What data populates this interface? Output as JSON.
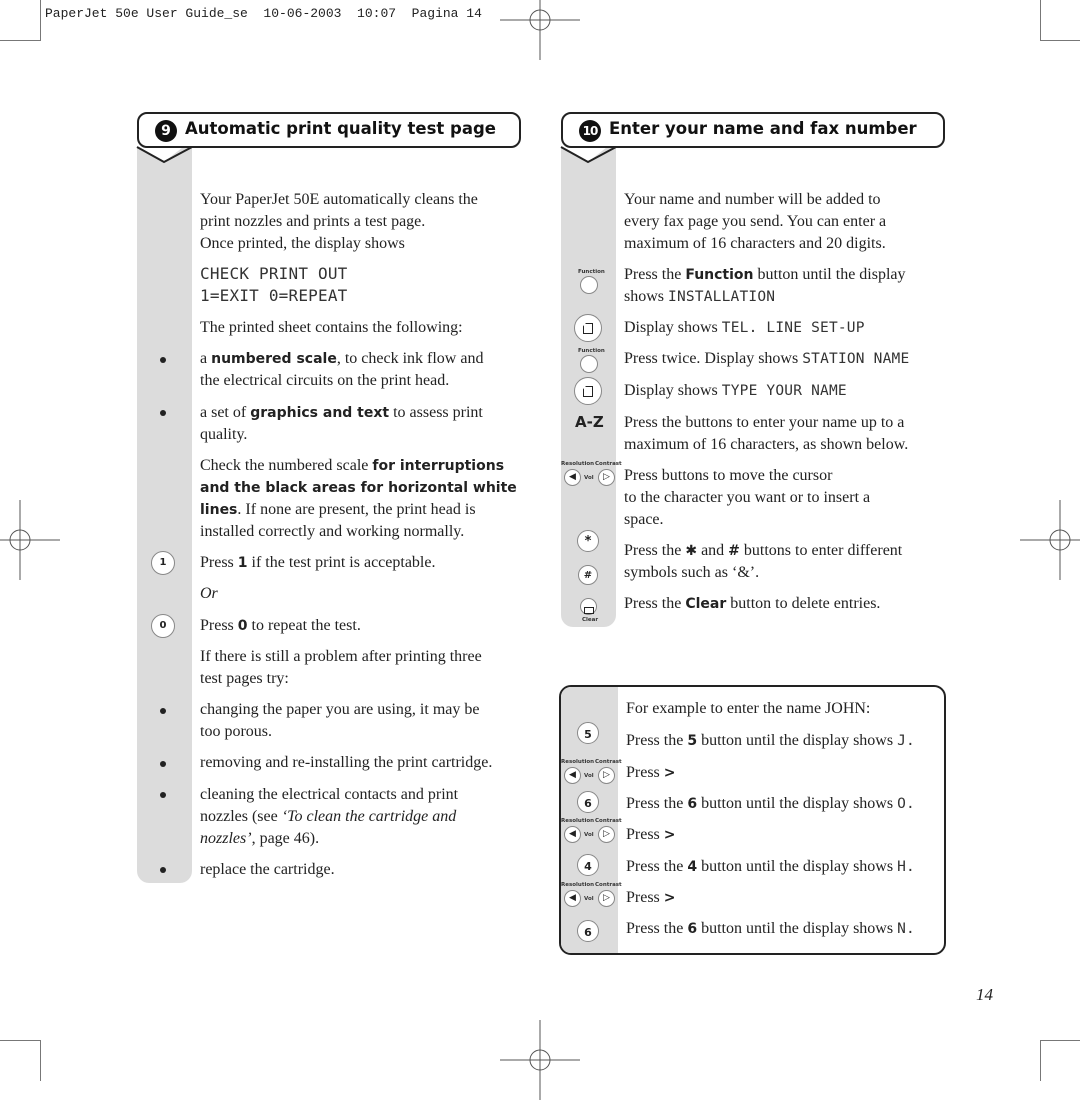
{
  "slug": "PaperJet 50e User Guide_se  10-06-2003  10:07  Pagina 14",
  "page_number": "14",
  "left_section": {
    "number": "9",
    "title": "Automatic print quality test page",
    "intro": [
      "Your PaperJet 50E automatically cleans the",
      "print nozzles and prints a test page.",
      "Once printed, the display shows"
    ],
    "display_lines": [
      "CHECK PRINT OUT",
      "1=EXIT 0=REPEAT"
    ],
    "sheet_intro": "The printed sheet contains the following:",
    "bullets_1": [
      {
        "pre": "a ",
        "bold": "numbered scale",
        "post": ", to check ink flow and",
        "line2": "the electrical circuits on the print head."
      },
      {
        "pre": "a set of ",
        "bold": "graphics and text",
        "post": " to assess print",
        "line2": "quality."
      }
    ],
    "check": {
      "line1_pre": "Check the numbered scale ",
      "line1_bold": "for interruptions",
      "line2_bold": "and the black areas for horizontal white",
      "line3_bold": "lines",
      "line3_post": ". If none are present, the print head is",
      "line4": "installed correctly and working normally."
    },
    "press1": {
      "key": "1",
      "pre": "Press ",
      "bold": "1",
      "post": " if the test print is acceptable."
    },
    "or": "Or",
    "press0": {
      "key": "0",
      "pre": "Press ",
      "bold": "0",
      "post": " to repeat the test."
    },
    "problem": [
      "If there is still a problem after printing three",
      "test pages try:"
    ],
    "bullets_2": [
      [
        "changing the paper you are using, it may be",
        "too porous."
      ],
      [
        "removing and re-installing the print cartridge."
      ],
      [
        "cleaning the electrical contacts and print"
      ],
      [
        "replace the cartridge."
      ]
    ],
    "cleaning_line2_pre": "nozzles (see ",
    "cleaning_line2_italic": "‘To clean the cartridge and",
    "cleaning_line3_italic": "nozzles’",
    "cleaning_line3_post": ", page 46)."
  },
  "right_section": {
    "number": "10",
    "title": "Enter your name and fax number",
    "intro": [
      "Your name and number will be added to",
      "every fax page you send. You can enter a",
      "maximum of 16 characters and 20 digits."
    ],
    "step_function": {
      "pre": "Press the ",
      "bold": "Function",
      "post": " button until the display",
      "line2_pre": "shows ",
      "line2_lcd": "INSTALLATION"
    },
    "step_tel": {
      "pre": "Display shows ",
      "lcd": "TEL. LINE SET-UP"
    },
    "step_twice": {
      "pre": "Press twice. Display shows ",
      "lcd": "STATION NAME"
    },
    "step_type": {
      "pre": "Display shows ",
      "lcd": "TYPE YOUR NAME"
    },
    "step_az": {
      "key_label": "A-Z",
      "lines": [
        "Press the buttons to enter your name up to a",
        "maximum of 16 characters, as shown below."
      ]
    },
    "step_cursor": [
      "Press buttons to move the cursor",
      "to the character you want or to insert a",
      "space."
    ],
    "step_symbols": {
      "pre": "Press the ",
      "star": "✱",
      "mid": " and ",
      "hash": "#",
      "post": " buttons to enter different",
      "line2": "symbols such as ‘&’."
    },
    "step_clear": {
      "pre": "Press the ",
      "bold": "Clear",
      "post": " button to delete entries."
    },
    "key_labels": {
      "function": "Function",
      "resolution": "Resolution",
      "contrast": "Contrast",
      "vol": "Vol",
      "clear": "Clear",
      "star": "*",
      "hash": "#"
    }
  },
  "example": {
    "intro": "For example to enter the name JOHN:",
    "steps": [
      {
        "type": "digit",
        "key": "5",
        "pre": "Press the ",
        "bold": "5",
        "post": " button until the display shows ",
        "lcd": "J."
      },
      {
        "type": "arrow",
        "pre": "Press ",
        "bold": ">"
      },
      {
        "type": "digit",
        "key": "6",
        "pre": "Press the ",
        "bold": "6",
        "post": " button until the display shows ",
        "lcd": "O."
      },
      {
        "type": "arrow",
        "pre": "Press ",
        "bold": ">"
      },
      {
        "type": "digit",
        "key": "4",
        "pre": "Press the ",
        "bold": "4",
        "post": " button until the display shows ",
        "lcd": "H."
      },
      {
        "type": "arrow",
        "pre": "Press ",
        "bold": ">"
      },
      {
        "type": "digit",
        "key": "6",
        "pre": "Press the ",
        "bold": "6",
        "post": " button until the display shows ",
        "lcd": "N."
      }
    ]
  }
}
